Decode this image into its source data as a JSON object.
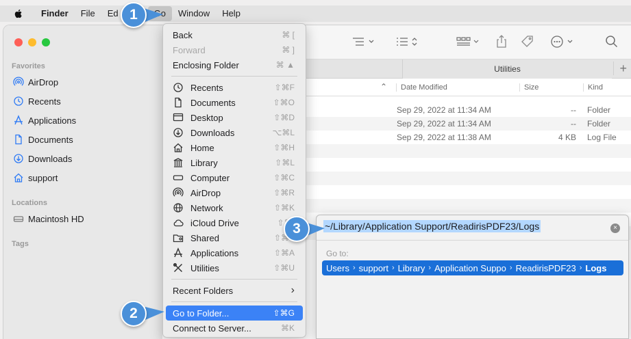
{
  "menubar": {
    "items": [
      {
        "label": "Finder",
        "bold": true
      },
      {
        "label": "File"
      },
      {
        "label": "Ed"
      },
      {
        "label": "Go",
        "active": true
      },
      {
        "label": "Window"
      },
      {
        "label": "Help"
      }
    ]
  },
  "sidebar": {
    "favorites_header": "Favorites",
    "favorites": [
      "AirDrop",
      "Recents",
      "Applications",
      "Documents",
      "Downloads",
      "support"
    ],
    "locations_header": "Locations",
    "locations": [
      "Macintosh HD"
    ],
    "tags_header": "Tags"
  },
  "tabs": {
    "active": "Utilities",
    "plus": "+"
  },
  "columns": {
    "date": "Date Modified",
    "size": "Size",
    "kind": "Kind"
  },
  "rows": [
    {
      "date": "Sep 29, 2022 at 11:34 AM",
      "size": "--",
      "kind": "Folder"
    },
    {
      "date": "Sep 29, 2022 at 11:34 AM",
      "size": "--",
      "kind": "Folder"
    },
    {
      "date": "Sep 29, 2022 at 11:38 AM",
      "size": "4 KB",
      "kind": "Log File"
    }
  ],
  "go_menu": {
    "back": {
      "label": "Back",
      "shortcut": "⌘ ["
    },
    "forward": {
      "label": "Forward",
      "shortcut": "⌘ ]"
    },
    "enclosing": {
      "label": "Enclosing Folder",
      "shortcut": "⌘ ▲"
    },
    "places": [
      {
        "label": "Recents",
        "shortcut": "⇧⌘F",
        "icon": "clock-icon"
      },
      {
        "label": "Documents",
        "shortcut": "⇧⌘O",
        "icon": "document-icon"
      },
      {
        "label": "Desktop",
        "shortcut": "⇧⌘D",
        "icon": "desktop-icon"
      },
      {
        "label": "Downloads",
        "shortcut": "⌥⌘L",
        "icon": "download-icon"
      },
      {
        "label": "Home",
        "shortcut": "⇧⌘H",
        "icon": "home-icon"
      },
      {
        "label": "Library",
        "shortcut": "⇧⌘L",
        "icon": "library-icon"
      },
      {
        "label": "Computer",
        "shortcut": "⇧⌘C",
        "icon": "computer-icon"
      },
      {
        "label": "AirDrop",
        "shortcut": "⇧⌘R",
        "icon": "airdrop-icon"
      },
      {
        "label": "Network",
        "shortcut": "⇧⌘K",
        "icon": "network-icon"
      },
      {
        "label": "iCloud Drive",
        "shortcut": "⇧⌘I",
        "icon": "cloud-icon"
      },
      {
        "label": "Shared",
        "shortcut": "⇧⌘S",
        "icon": "shared-folder-icon"
      },
      {
        "label": "Applications",
        "shortcut": "⇧⌘A",
        "icon": "applications-icon"
      },
      {
        "label": "Utilities",
        "shortcut": "⇧⌘U",
        "icon": "utilities-icon"
      }
    ],
    "recent_folders": {
      "label": "Recent Folders",
      "arrow": "›"
    },
    "go_to_folder": {
      "label": "Go to Folder...",
      "shortcut": "⇧⌘G"
    },
    "connect": {
      "label": "Connect to Server...",
      "shortcut": "⌘K"
    }
  },
  "goto_dialog": {
    "input_value": "~/Library/Application Support/ReadirisPDF23/Logs",
    "clear": "×",
    "label": "Go to:",
    "path": [
      "Users",
      "support",
      "Library",
      "Application Suppo",
      "ReadirisPDF23",
      "Logs"
    ],
    "separator": "›"
  },
  "callouts": {
    "one": "1",
    "two": "2",
    "three": "3"
  },
  "colors": {
    "accent": "#3b82f6",
    "callout": "#4a90d9",
    "path_bar": "#1a6fd8",
    "selection": "#b3d7ff"
  }
}
